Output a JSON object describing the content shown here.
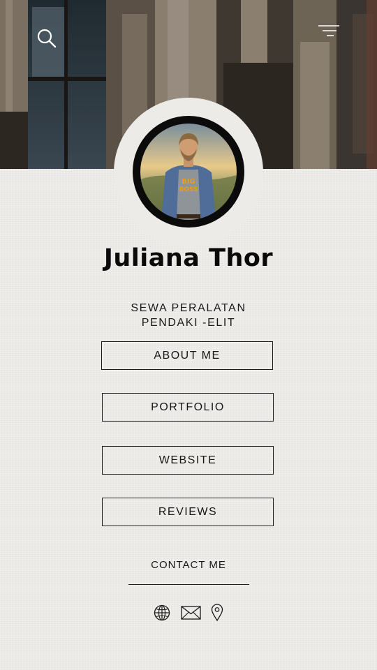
{
  "profile": {
    "name": "Juliana Thor",
    "tagline_line1": "SEWA PERALATAN",
    "tagline_line2": "PENDAKI -ELIT",
    "avatar_shirt_text_1": "BIG",
    "avatar_shirt_text_2": "BOSS"
  },
  "header": {
    "search_icon": "search-icon",
    "menu_icon": "hamburger-menu-icon"
  },
  "links": [
    {
      "label": "ABOUT ME"
    },
    {
      "label": "PORTFOLIO"
    },
    {
      "label": "WEBSITE"
    },
    {
      "label": "REVIEWS"
    }
  ],
  "contact": {
    "title": "CONTACT ME",
    "icons": [
      "globe-icon",
      "mail-icon",
      "location-pin-icon"
    ]
  },
  "colors": {
    "background": "#ecebe8",
    "text": "#111111",
    "avatar_ring": "#0b0b0b"
  }
}
